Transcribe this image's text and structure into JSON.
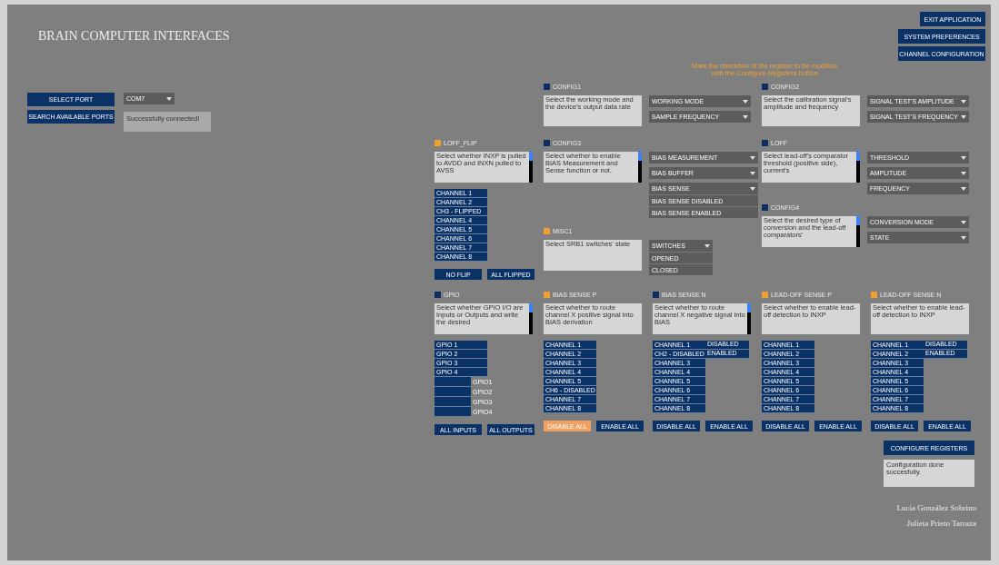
{
  "title": "BRAIN COMPUTER INTERFACES",
  "top_buttons": [
    "EXIT APPLICATION",
    "SYSTEM PREFERENCES",
    "CHANNEL CONFIGURATION"
  ],
  "port": {
    "buttons": [
      "SELECT PORT",
      "SEARCH AVAILABLE PORTS"
    ],
    "selected_port": "COM7",
    "status": "Successfully connected!"
  },
  "notice": [
    "Mark the checkbox of the register to be modified",
    "with the Configure Registers button"
  ],
  "registers": [
    {
      "name": "CONFIG1",
      "checked": false,
      "kind": "dropdowns",
      "description": "Select the working mode and the device's output data rate",
      "scrollbar": false,
      "dropdowns": [
        {
          "label": "WORKING MODE"
        },
        {
          "label": "SAMPLE FREQUENCY"
        }
      ]
    },
    {
      "name": "CONFIG2",
      "checked": false,
      "kind": "dropdowns",
      "description": "Select the calibration signal's amplitude and frequency",
      "scrollbar": false,
      "dropdowns": [
        {
          "label": "SIGNAL TEST'S AMPLITUDE"
        },
        {
          "label": "SIGNAL TEST'S FREQUENCY"
        }
      ]
    },
    {
      "name": "LOFF_FLIP",
      "checked": true,
      "kind": "channels",
      "description": "Select whether INXP is pulled to AVDD and INXN pulled to AVSS",
      "scrollbar": true,
      "channels": [
        "CHANNEL 1",
        "CHANNEL 2",
        "CH3 - FLIPPED",
        "CHANNEL 4",
        "CHANNEL 5",
        "CHANNEL 6",
        "CHANNEL 7",
        "CHANNEL 8"
      ],
      "buttons": [
        {
          "label": "NO FLIP",
          "selected": false
        },
        {
          "label": "ALL FLIPPED",
          "selected": false
        }
      ]
    },
    {
      "name": "CONFIG3",
      "checked": false,
      "kind": "dropdowns",
      "description": "Select whether to enable BIAS Measurement and Sense function or not.",
      "scrollbar": true,
      "dropdowns": [
        {
          "label": "BIAS MEASUREMENT"
        },
        {
          "label": "BIAS BUFFER"
        },
        {
          "label": "BIAS SENSE",
          "options": [
            "BIAS SENSE DISABLED",
            "BIAS SENSE ENABLED"
          ]
        }
      ]
    },
    {
      "name": "MISC1",
      "checked": true,
      "kind": "dropdowns",
      "description": "Select SRB1 switches' state",
      "scrollbar": false,
      "dropdowns": [
        {
          "label": "SWITCHES",
          "options": [
            "OPENED",
            "CLOSED"
          ]
        }
      ]
    },
    {
      "name": "LOFF",
      "checked": false,
      "kind": "dropdowns",
      "description": "Select lead-off's comparator threshold (positive side), current's",
      "scrollbar": true,
      "dropdowns": [
        {
          "label": "THRESHOLD"
        },
        {
          "label": "AMPLITUDE"
        },
        {
          "label": "FREQUENCY"
        }
      ]
    },
    {
      "name": "CONFIG4",
      "checked": false,
      "kind": "dropdowns",
      "description": "Select the desired type of conversion and the lead-off comparators'",
      "scrollbar": true,
      "dropdowns": [
        {
          "label": "CONVERSION MODE"
        },
        {
          "label": "STATE"
        }
      ]
    },
    {
      "name": "GPIO",
      "checked": false,
      "kind": "channels",
      "description": "Select whether GPIO I/O are Inputs or Outputs and write the desired",
      "scrollbar": true,
      "channels": [
        "GPIO 1",
        "GPIO 2",
        "GPIO 3",
        "GPIO 4"
      ],
      "outputs": [
        "GPIO1",
        "GPIO2",
        "GPIO3",
        "GPIO4"
      ],
      "buttons": [
        {
          "label": "ALL INPUTS",
          "selected": false
        },
        {
          "label": "ALL OUTPUTS",
          "selected": false
        }
      ]
    },
    {
      "name": "BIAS SENSE P",
      "checked": true,
      "kind": "channels",
      "description": "Select whether to route channel X positive signal into BIAS derivation",
      "scrollbar": false,
      "channels": [
        "CHANNEL 1",
        "CHANNEL 2",
        "CHANNEL 3",
        "CHANNEL 4",
        "CHANNEL 5",
        "CH6 - DISABLED",
        "CHANNEL 7",
        "CHANNEL 8"
      ],
      "buttons": [
        {
          "label": "DISABLE ALL",
          "selected": true
        },
        {
          "label": "ENABLE ALL",
          "selected": false
        }
      ]
    },
    {
      "name": "BIAS SENSE N",
      "checked": false,
      "kind": "channels",
      "description": "Select whether to route channel X negative signal into BIAS",
      "scrollbar": true,
      "channels": [
        "CHANNEL 1",
        "CH2 - DISABLED",
        "CHANNEL 3",
        "CHANNEL 4",
        "CHANNEL 5",
        "CHANNEL 6",
        "CHANNEL 7",
        "CHANNEL 8"
      ],
      "channel_options": [
        "DISABLED",
        "ENABLED"
      ],
      "buttons": [
        {
          "label": "DISABLE ALL",
          "selected": false
        },
        {
          "label": "ENABLE ALL",
          "selected": false
        }
      ]
    },
    {
      "name": "LEAD-OFF SENSE P",
      "checked": true,
      "kind": "channels",
      "description": "Select whether to enable lead-off detection to INXP",
      "scrollbar": false,
      "channels": [
        "CHANNEL 1",
        "CHANNEL 2",
        "CHANNEL 3",
        "CHANNEL 4",
        "CHANNEL 5",
        "CHANNEL 6",
        "CHANNEL 7",
        "CHANNEL 8"
      ],
      "buttons": [
        {
          "label": "DISABLE ALL",
          "selected": false
        },
        {
          "label": "ENABLE ALL",
          "selected": false
        }
      ]
    },
    {
      "name": "LEAD-OFF SENSE N",
      "checked": true,
      "kind": "channels",
      "description": "Select whether to enable lead-off detection to INXP",
      "scrollbar": false,
      "channels": [
        "CHANNEL 1",
        "CHANNEL 2",
        "CHANNEL 3",
        "CHANNEL 4",
        "CHANNEL 5",
        "CHANNEL 6",
        "CHANNEL 7",
        "CHANNEL 8"
      ],
      "channel_options": [
        "DISABLED",
        "ENABLED"
      ],
      "buttons": [
        {
          "label": "DISABLE ALL",
          "selected": false
        },
        {
          "label": "ENABLE ALL",
          "selected": false
        }
      ]
    }
  ],
  "configure_button": "CONFIGURE REGISTERS",
  "configure_status": "Configuration done succesfully.",
  "authors": [
    "Lucia González Sobrino",
    "Julieta Prieto Tarraza"
  ]
}
